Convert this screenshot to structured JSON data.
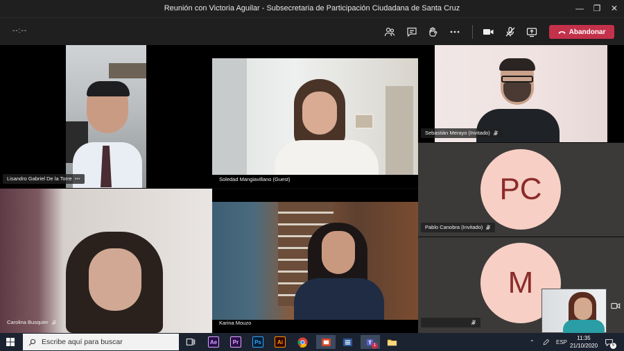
{
  "window": {
    "title": "Reunión con Victoria Aguilar - Subsecretaria de Participación Ciudadana de Santa Cruz",
    "minimize_icon": "minimize-icon",
    "maximize_icon": "maximize-icon",
    "close_icon": "close-icon"
  },
  "toolbar": {
    "timer": "--:--",
    "leave_label": "Abandonar",
    "icons": [
      "participants-icon",
      "chat-icon",
      "raise-hand-icon",
      "more-icon",
      "camera-icon",
      "mic-off-icon",
      "share-screen-icon"
    ],
    "leave_color": "#c4314b"
  },
  "participants": [
    {
      "name": "Lisandro Gabriel De la Torre",
      "more": "•••",
      "mic": "none"
    },
    {
      "name": "Soledad Mangiavillano (Guest)",
      "mic": "none"
    },
    {
      "name": "Sebastián Merayo (Invitado)",
      "mic": "muted"
    },
    {
      "name": "Pablo Canobra (Invitado)",
      "initials": "PC",
      "mic": "muted"
    },
    {
      "name": "Carolina Busquier",
      "mic": "muted"
    },
    {
      "name": "Karina Mouzo",
      "mic": "none"
    },
    {
      "name": "",
      "initials": "M",
      "mic": "muted"
    }
  ],
  "taskbar": {
    "search_placeholder": "Escribe aquí para buscar",
    "apps": [
      {
        "name": "Ae",
        "color": "#2a0f4a",
        "fg": "#d6a4ff"
      },
      {
        "name": "Pr",
        "color": "#2a0f4a",
        "fg": "#e6a8ff"
      },
      {
        "name": "Ps",
        "color": "#001d34",
        "fg": "#31a8ff"
      },
      {
        "name": "Ai",
        "color": "#330000",
        "fg": "#ff9a00"
      }
    ],
    "language": "ESP",
    "time": "11:35",
    "date": "21/10/2020",
    "notifications": "5",
    "teams_badge": "1"
  }
}
